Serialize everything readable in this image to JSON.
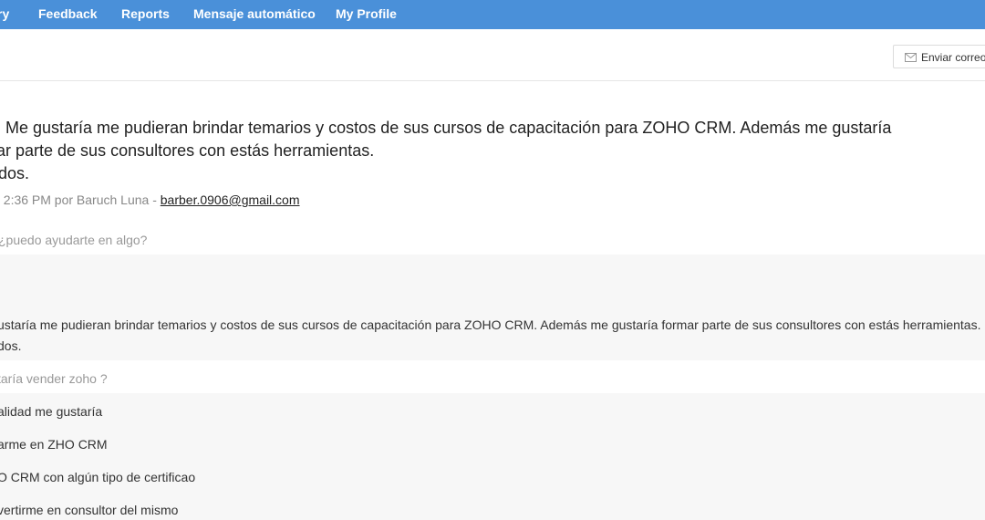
{
  "nav": {
    "items": [
      "ry",
      "Feedback",
      "Reports",
      "Mensaje automático",
      "My Profile"
    ]
  },
  "toolbar": {
    "send_label": "Enviar correo",
    "send_icon": "mail-icon"
  },
  "message": {
    "lines": [
      ". Me gustaría me pudieran brindar temarios y costos de sus cursos de capacitación para ZOHO CRM. Además me gustaría",
      "ar parte de sus consultores con estás herramientas.",
      "dos."
    ],
    "meta_prefix": ", 2:36 PM por Baruch Luna - ",
    "email": "barber.0906@gmail.com"
  },
  "qa": [
    {
      "question": "¿puedo ayudarte en algo?",
      "answers": [
        "ustaría me pudieran brindar temarios y costos de sus cursos de capacitación para ZOHO CRM. Además me gustaría formar parte de sus consultores con estás herramientas.",
        "dos."
      ]
    },
    {
      "question": "taría vender zoho ?",
      "answers": [
        "alidad me gustaría",
        "arme en ZHO CRM",
        "O CRM con algún tipo de certificao",
        "vertirme en consultor del mismo"
      ]
    }
  ]
}
